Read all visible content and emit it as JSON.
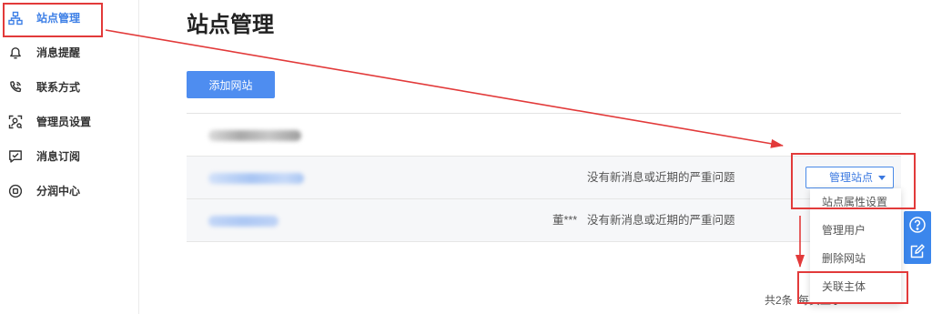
{
  "sidebar": {
    "active_index": 0,
    "items": [
      {
        "label": "站点管理",
        "icon": "sitemap-icon"
      },
      {
        "label": "消息提醒",
        "icon": "bell-icon"
      },
      {
        "label": "联系方式",
        "icon": "phone-icon"
      },
      {
        "label": "管理员设置",
        "icon": "admin-settings-icon"
      },
      {
        "label": "消息订阅",
        "icon": "message-subscribe-icon"
      },
      {
        "label": "分润中心",
        "icon": "profit-share-icon"
      }
    ]
  },
  "main": {
    "title": "站点管理",
    "add_site_label": "添加网站",
    "rows": [
      {},
      {
        "status": "没有新消息或近期的严重问题",
        "action_label": "管理站点"
      },
      {
        "owner": "董***",
        "status": "没有新消息或近期的严重问题"
      }
    ],
    "manage_menu": {
      "items": [
        "站点属性设置",
        "管理用户",
        "删除网站",
        "关联主体"
      ]
    },
    "pagination": {
      "total": "共2条",
      "page_size_label": "每页显示"
    }
  },
  "float_toolbar": {
    "icons": [
      "help-icon",
      "feedback-icon"
    ]
  },
  "colors": {
    "accent": "#3d7fe6",
    "primary_button": "#4e8df0",
    "float_toolbar": "#3b86ec",
    "annotation": "#e23a3a"
  }
}
